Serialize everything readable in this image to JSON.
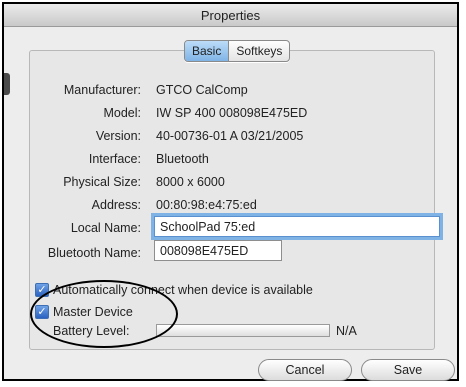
{
  "window": {
    "title": "Properties"
  },
  "tabs": [
    {
      "label": "Basic",
      "selected": true
    },
    {
      "label": "Softkeys",
      "selected": false
    }
  ],
  "fields": {
    "manufacturer": {
      "label": "Manufacturer:",
      "value": "GTCO CalComp"
    },
    "model": {
      "label": "Model:",
      "value": "IW SP 400 008098E475ED"
    },
    "version": {
      "label": "Version:",
      "value": "40-00736-01 A 03/21/2005"
    },
    "interface": {
      "label": "Interface:",
      "value": "Bluetooth"
    },
    "physical_size": {
      "label": "Physical Size:",
      "value": "8000 x 6000"
    },
    "address": {
      "label": "Address:",
      "value": "00:80:98:e4:75:ed"
    },
    "local_name": {
      "label": "Local Name:",
      "value": "SchoolPad 75:ed"
    },
    "bluetooth_name": {
      "label": "Bluetooth Name:",
      "value": "008098E475ED"
    }
  },
  "checkboxes": {
    "auto_connect": {
      "label": "Automatically connect when device is available",
      "checked": true
    },
    "master_device": {
      "label": "Master Device",
      "checked": true
    }
  },
  "battery": {
    "label": "Battery Level:",
    "value": "N/A",
    "level": null
  },
  "buttons": {
    "cancel": "Cancel",
    "save": "Save"
  },
  "icons": {
    "check": "✓"
  },
  "colors": {
    "accent": "#7fb2e5",
    "checkbox": "#2a62c0"
  }
}
